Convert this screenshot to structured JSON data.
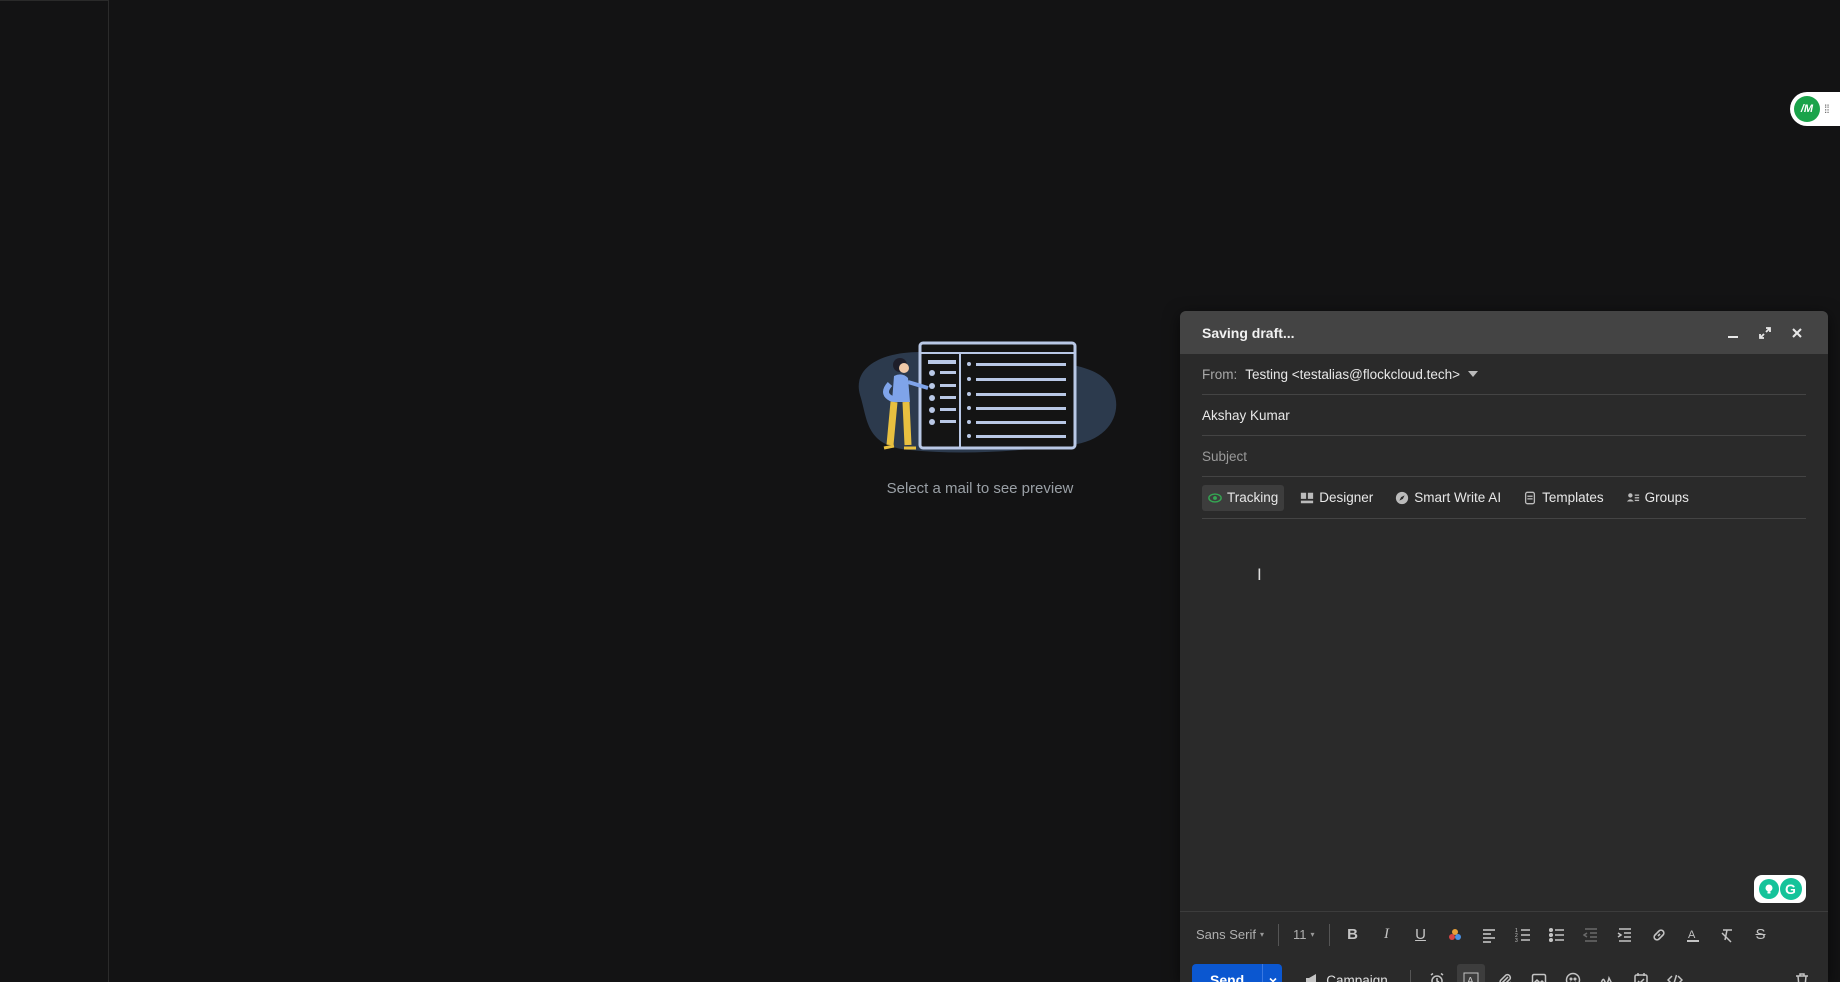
{
  "empty_state": {
    "text": "Select a mail to see preview"
  },
  "extension": {
    "logo_text": "/M"
  },
  "compose": {
    "title": "Saving draft...",
    "from_label": "From:",
    "from_value": "Testing <testalias@flockcloud.tech>",
    "to_value": "Akshay Kumar",
    "subject_placeholder": "Subject",
    "features": [
      {
        "label": "Tracking",
        "icon": "eye-icon"
      },
      {
        "label": "Designer",
        "icon": "layout-icon"
      },
      {
        "label": "Smart Write AI",
        "icon": "compass-icon"
      },
      {
        "label": "Templates",
        "icon": "template-icon"
      },
      {
        "label": "Groups",
        "icon": "groups-icon"
      }
    ],
    "format": {
      "font_family": "Sans Serif",
      "font_size": "11"
    },
    "send_label": "Send",
    "campaign_label": "Campaign"
  },
  "colors": {
    "accent": "#0b57d0",
    "tracking_eye": "#34a853",
    "background": "#131314",
    "compose_bg": "#2a2a2a"
  }
}
